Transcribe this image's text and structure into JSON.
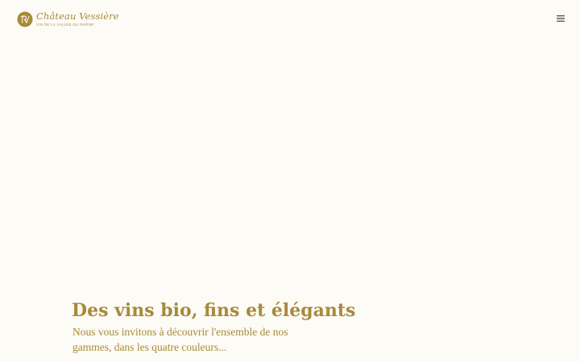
{
  "header": {
    "logo": {
      "monogram": "CV",
      "name": "Château Vessière",
      "tagline": "VIN DE LA VALLÉE DU RHÔNE",
      "icon": "monogram-emblem-icon"
    },
    "menu": {
      "icon": "hamburger-menu-icon"
    }
  },
  "hero": {
    "title": "Des vins bio, fins et élégants",
    "text": "Nous vous invitons à découvrir l'ensemble de nos gammes, dans les quatre couleurs..."
  },
  "colors": {
    "background": "#fdfbf6",
    "gold": "#a78a3a",
    "icon": "#555555"
  }
}
